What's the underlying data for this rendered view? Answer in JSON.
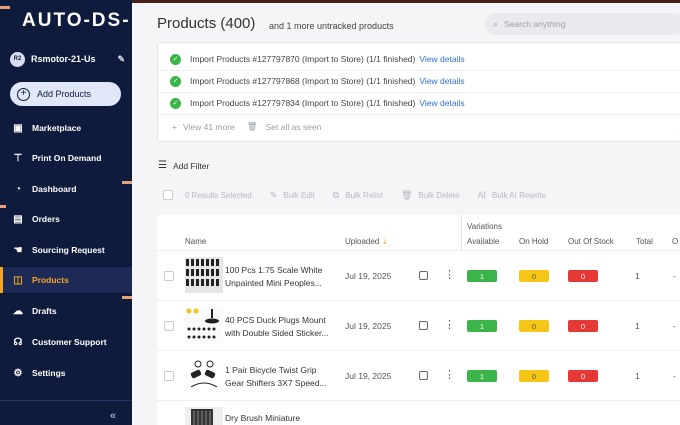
{
  "app": {
    "logo": "AUTO-DS-"
  },
  "user": {
    "initials": "R2",
    "name": "Rsmotor-21-Us"
  },
  "sidebar": {
    "add_products": "Add Products",
    "items": [
      {
        "label": "Marketplace",
        "icon": "store-icon"
      },
      {
        "label": "Print On Demand",
        "icon": "shirt-icon"
      },
      {
        "label": "Dashboard",
        "icon": "gauge-icon"
      },
      {
        "label": "Orders",
        "icon": "clipboard-icon"
      },
      {
        "label": "Sourcing Request",
        "icon": "hand-icon"
      },
      {
        "label": "Products",
        "icon": "box-icon",
        "active": true
      },
      {
        "label": "Drafts",
        "icon": "cloud-upload-icon"
      },
      {
        "label": "Customer Support",
        "icon": "headset-icon"
      },
      {
        "label": "Settings",
        "icon": "gear-icon"
      }
    ],
    "collapse": "«"
  },
  "header": {
    "title": "Products (400)",
    "subtitle": "and 1 more untracked products",
    "search_placeholder": "Search anything"
  },
  "notifications": [
    {
      "text": "Import Products #127797870 (Import to Store) (1/1 finished)",
      "link": "View details"
    },
    {
      "text": "Import Products #127797868 (Import to Store) (1/1 finished)",
      "link": "View details"
    },
    {
      "text": "Import Products #127797834 (Import to Store) (1/1 finished)",
      "link": "View details"
    }
  ],
  "notif_footer": {
    "view_more": "View 41 more",
    "set_seen": "Set all as seen"
  },
  "filter": {
    "label": "Add Filter"
  },
  "bulk": {
    "selected": "0 Results Selected",
    "edit": "Bulk Edit",
    "relist": "Bulk Relist",
    "delete": "Bulk Delete",
    "ai": "Bulk AI Rewrite"
  },
  "table": {
    "headers": {
      "name": "Name",
      "uploaded": "Uploaded",
      "variations": "Variations",
      "available": "Available",
      "on_hold": "On Hold",
      "out_of_stock": "Out Of Stock",
      "total": "Total",
      "extra": "O"
    },
    "rows": [
      {
        "name": "100 Pcs 1:75 Scale White Unpainted Mini Peoples...",
        "date": "Jul 19, 2025",
        "available": "1",
        "on_hold": "0",
        "out_of_stock": "0",
        "total": "1",
        "extra": "-"
      },
      {
        "name": "40 PCS Duck Plugs Mount with Double Sided Sticker...",
        "date": "Jul 19, 2025",
        "available": "1",
        "on_hold": "0",
        "out_of_stock": "0",
        "total": "1",
        "extra": "-"
      },
      {
        "name": "1 Pair Bicycle Twist Grip Gear Shifters 3X7 Speed...",
        "date": "Jul 19, 2025",
        "available": "1",
        "on_hold": "0",
        "out_of_stock": "0",
        "total": "1",
        "extra": "-"
      },
      {
        "name": "Dry Brush Miniature",
        "date": "",
        "available": "",
        "on_hold": "",
        "out_of_stock": "",
        "total": "",
        "extra": ""
      }
    ]
  },
  "colors": {
    "sidebar": "#0f1b3d",
    "active": "#f5a623",
    "green": "#3bb54a",
    "yellow": "#f5c518",
    "red": "#e53935",
    "link": "#2f6fd6"
  }
}
